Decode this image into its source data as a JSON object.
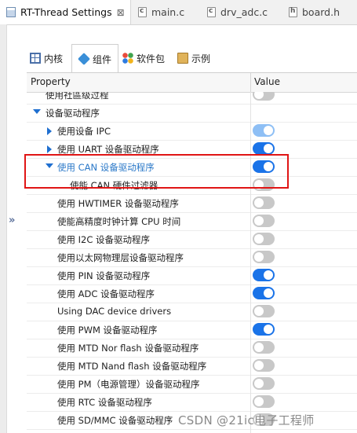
{
  "editor_tabs": [
    {
      "label": "RT-Thread Settings",
      "icon": "settings-icon",
      "active": true,
      "close": "⊠"
    },
    {
      "label": "main.c",
      "icon": "c-file-icon",
      "letter": "c"
    },
    {
      "label": "drv_adc.c",
      "icon": "c-file-icon",
      "letter": "c"
    },
    {
      "label": "board.h",
      "icon": "h-file-icon",
      "letter": "h"
    }
  ],
  "side_toggle": "»",
  "sub_tabs": [
    {
      "label": "内核",
      "icon": "grid-icon"
    },
    {
      "label": "组件",
      "icon": "cube-icon",
      "active": true
    },
    {
      "label": "软件包",
      "icon": "dots-icon"
    },
    {
      "label": "示例",
      "icon": "package-icon"
    }
  ],
  "table": {
    "property_header": "Property",
    "value_header": "Value"
  },
  "rows": [
    {
      "label": "使用社區级过程",
      "toggle": "off"
    },
    {
      "label": "设备驱动程序",
      "caret": "down",
      "indent": 1
    },
    {
      "label": "使用设备 IPC",
      "caret": "right",
      "indent": 2,
      "toggle": "on-dim"
    },
    {
      "label": "使用 UART 设备驱动程序",
      "caret": "right",
      "indent": 2,
      "toggle": "on"
    },
    {
      "label": "使用 CAN 设备驱动程序",
      "caret": "down",
      "indent": 2,
      "toggle": "on",
      "highlight": true
    },
    {
      "label": "使能 CAN 硬件过滤器",
      "indent": 3,
      "toggle": "off"
    },
    {
      "label": "使用 HWTIMER 设备驱动程序",
      "indent": 2,
      "toggle": "off"
    },
    {
      "label": "使能高精度时钟计算 CPU 时间",
      "indent": 2,
      "toggle": "off"
    },
    {
      "label": "使用 I2C 设备驱动程序",
      "indent": 2,
      "toggle": "off"
    },
    {
      "label": "使用以太网物理层设备驱动程序",
      "indent": 2,
      "toggle": "off"
    },
    {
      "label": "使用 PIN 设备驱动程序",
      "indent": 2,
      "toggle": "on"
    },
    {
      "label": "使用 ADC 设备驱动程序",
      "indent": 2,
      "toggle": "on"
    },
    {
      "label": "Using DAC device drivers",
      "indent": 2,
      "toggle": "off"
    },
    {
      "label": "使用 PWM 设备驱动程序",
      "indent": 2,
      "toggle": "on"
    },
    {
      "label": "使用 MTD Nor flash 设备驱动程序",
      "indent": 2,
      "toggle": "off"
    },
    {
      "label": "使用 MTD Nand flash 设备驱动程序",
      "indent": 2,
      "toggle": "off"
    },
    {
      "label": "使用 PM（电源管理）设备驱动程序",
      "indent": 2,
      "toggle": "off"
    },
    {
      "label": "使用 RTC 设备驱动程序",
      "indent": 2,
      "toggle": "off"
    },
    {
      "label": "使用 SD/MMC 设备驱动程序",
      "indent": 2,
      "toggle": "off"
    }
  ],
  "watermark": "CSDN @21ic电子工程师",
  "colors": {
    "toggle_on": "#1a73e8",
    "toggle_off": "#c8c8c8",
    "highlight_text": "#2a78c8",
    "annotation_box": "#e01515"
  }
}
